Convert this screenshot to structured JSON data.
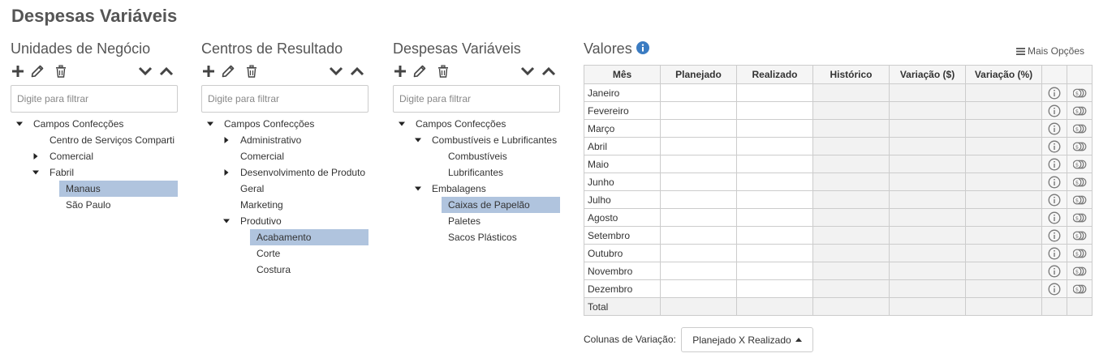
{
  "page_title": "Despesas Variáveis",
  "colors": {
    "selection": "#b0c4de",
    "info_blue": "#3b7cc2",
    "border": "#cccccc"
  },
  "panels": [
    {
      "title": "Unidades de Negócio",
      "filter_placeholder": "Digite para filtrar",
      "tree": [
        {
          "label": "Campos Confecções",
          "level": 0,
          "toggle": "expanded",
          "selected": false
        },
        {
          "label": "Centro de Serviços Comparti",
          "level": 1,
          "toggle": "none",
          "selected": false
        },
        {
          "label": "Comercial",
          "level": 1,
          "toggle": "collapsed",
          "selected": false
        },
        {
          "label": "Fabril",
          "level": 1,
          "toggle": "expanded",
          "selected": false
        },
        {
          "label": "Manaus",
          "level": 2,
          "toggle": "none",
          "selected": true
        },
        {
          "label": "São Paulo",
          "level": 2,
          "toggle": "none",
          "selected": false
        }
      ]
    },
    {
      "title": "Centros de Resultado",
      "filter_placeholder": "Digite para filtrar",
      "tree": [
        {
          "label": "Campos Confecções",
          "level": 0,
          "toggle": "expanded",
          "selected": false
        },
        {
          "label": "Administrativo",
          "level": 1,
          "toggle": "collapsed",
          "selected": false
        },
        {
          "label": "Comercial",
          "level": 1,
          "toggle": "none",
          "selected": false
        },
        {
          "label": "Desenvolvimento de Produto",
          "level": 1,
          "toggle": "collapsed",
          "selected": false
        },
        {
          "label": "Geral",
          "level": 1,
          "toggle": "none",
          "selected": false
        },
        {
          "label": "Marketing",
          "level": 1,
          "toggle": "none",
          "selected": false
        },
        {
          "label": "Produtivo",
          "level": 1,
          "toggle": "expanded",
          "selected": false
        },
        {
          "label": "Acabamento",
          "level": 2,
          "toggle": "none",
          "selected": true
        },
        {
          "label": "Corte",
          "level": 2,
          "toggle": "none",
          "selected": false
        },
        {
          "label": "Costura",
          "level": 2,
          "toggle": "none",
          "selected": false
        }
      ]
    },
    {
      "title": "Despesas Variáveis",
      "filter_placeholder": "Digite para filtrar",
      "tree": [
        {
          "label": "Campos Confecções",
          "level": 0,
          "toggle": "expanded",
          "selected": false
        },
        {
          "label": "Combustíveis e Lubrificantes",
          "level": 1,
          "toggle": "expanded",
          "selected": false
        },
        {
          "label": "Combustíveis",
          "level": 2,
          "toggle": "none",
          "selected": false
        },
        {
          "label": "Lubrificantes",
          "level": 2,
          "toggle": "none",
          "selected": false
        },
        {
          "label": "Embalagens",
          "level": 1,
          "toggle": "expanded",
          "selected": false
        },
        {
          "label": "Caixas de Papelão",
          "level": 2,
          "toggle": "none",
          "selected": true
        },
        {
          "label": "Paletes",
          "level": 2,
          "toggle": "none",
          "selected": false
        },
        {
          "label": "Sacos Plásticos",
          "level": 2,
          "toggle": "none",
          "selected": false
        }
      ]
    }
  ],
  "toolbar_icons": [
    "plus-icon",
    "pencil-icon",
    "trash-icon",
    "chevron-down-icon",
    "chevron-up-icon"
  ],
  "valores": {
    "title": "Valores",
    "mais_opcoes": "Mais Opções",
    "columns": [
      "Mês",
      "Planejado",
      "Realizado",
      "Histórico",
      "Variação ($)",
      "Variação (%)"
    ],
    "months": [
      "Janeiro",
      "Fevereiro",
      "Março",
      "Abril",
      "Maio",
      "Junho",
      "Julho",
      "Agosto",
      "Setembro",
      "Outubro",
      "Novembro",
      "Dezembro"
    ],
    "total_label": "Total"
  },
  "variation": {
    "label": "Colunas de Variação:",
    "selected": "Planejado X Realizado"
  }
}
